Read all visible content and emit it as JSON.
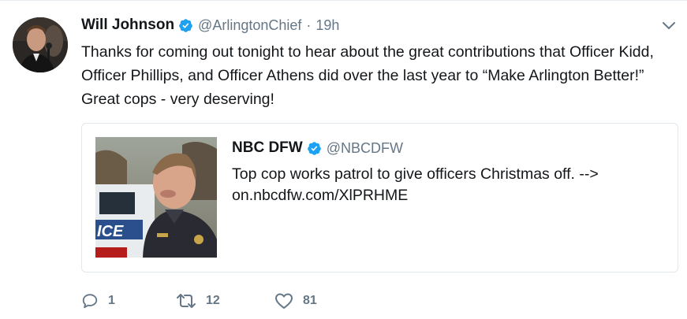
{
  "tweet": {
    "author": {
      "display_name": "Will Johnson",
      "handle": "@ArlingtonChief",
      "verified": true
    },
    "separator": "·",
    "time": "19h",
    "text": "Thanks for coming out tonight to hear about the great contributions that Officer Kidd, Officer Phillips, and Officer Athens did over the last year to “Make Arlington Better!” Great cops - very deserving!"
  },
  "quoted": {
    "display_name": "NBC DFW",
    "handle": "@NBCDFW",
    "verified": true,
    "text_line1": "Top cop works patrol to give officers Christmas off. -->",
    "text_line2": "on.nbcdfw.com/XlPRHME"
  },
  "actions": {
    "reply_count": "1",
    "retweet_count": "12",
    "like_count": "81"
  },
  "colors": {
    "text": "#14171a",
    "secondary": "#657786",
    "verified": "#1da1f2",
    "border": "#e1e8ed"
  },
  "icons": [
    "verified-badge-icon",
    "chevron-down-icon",
    "reply-icon",
    "retweet-icon",
    "like-icon"
  ]
}
